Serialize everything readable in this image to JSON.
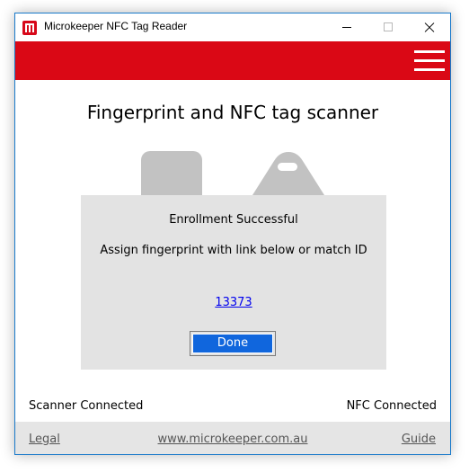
{
  "window": {
    "title": "Microkeeper NFC Tag Reader"
  },
  "colors": {
    "brand_red": "#da0815",
    "button_blue": "#1066dd",
    "link_blue": "#0000ee",
    "modal_bg": "#e3e3e3",
    "footer_bg": "#e5e5e5"
  },
  "icons": {
    "app": "microkeeper-logo-icon",
    "menu": "hamburger-menu-icon",
    "fingerprint": "fingerprint-scanner-icon",
    "nfc": "nfc-tag-icon"
  },
  "main": {
    "heading": "Fingerprint and NFC tag scanner"
  },
  "dialog": {
    "title": "Enrollment Successful",
    "message": "Assign fingerprint with link below or match ID",
    "id_link": "13373",
    "done_label": "Done"
  },
  "status": {
    "scanner": "Scanner Connected",
    "nfc": "NFC Connected"
  },
  "footer": {
    "legal": "Legal",
    "website": "www.microkeeper.com.au",
    "guide": "Guide"
  }
}
